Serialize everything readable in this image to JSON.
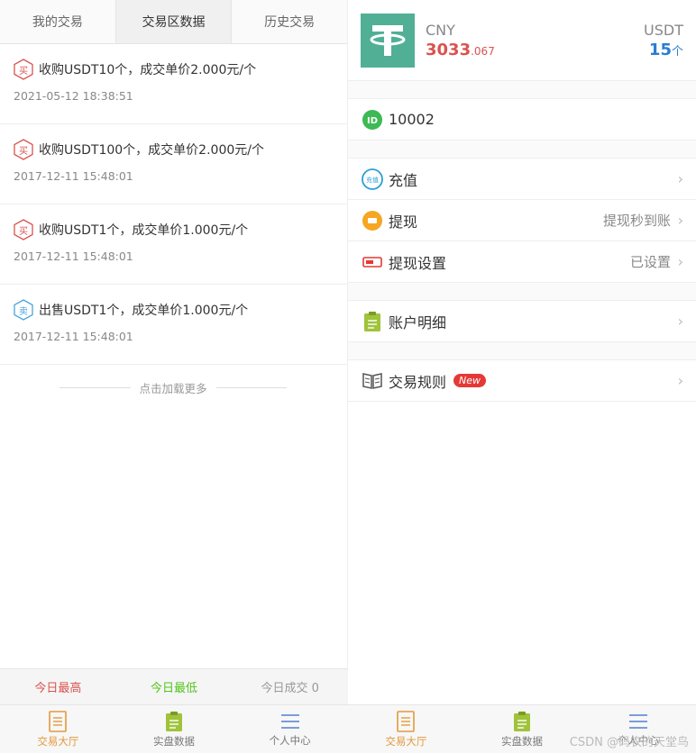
{
  "left": {
    "tabs": [
      "我的交易",
      "交易区数据",
      "历史交易"
    ],
    "active_tab": 1,
    "trades": [
      {
        "type": "buy",
        "badge": "买",
        "text": "收购USDT10个，成交单价2.000元/个",
        "time": "2021-05-12 18:38:51"
      },
      {
        "type": "buy",
        "badge": "买",
        "text": "收购USDT100个，成交单价2.000元/个",
        "time": "2017-12-11 15:48:01"
      },
      {
        "type": "buy",
        "badge": "买",
        "text": "收购USDT1个，成交单价1.000元/个",
        "time": "2017-12-11 15:48:01"
      },
      {
        "type": "sell",
        "badge": "卖",
        "text": "出售USDT1个，成交单价1.000元/个",
        "time": "2017-12-11 15:48:01"
      }
    ],
    "load_more": "点击加载更多",
    "stats": {
      "high": "今日最高",
      "low": "今日最低",
      "volume": "今日成交 0"
    },
    "nav": [
      "交易大厅",
      "实盘数据",
      "个人中心"
    ]
  },
  "right": {
    "cny_label": "CNY",
    "cny_int": "3033",
    "cny_dec": ".067",
    "usdt_label": "USDT",
    "usdt_val": "15",
    "usdt_unit": "个",
    "id": "10002",
    "menu": {
      "recharge": "充值",
      "recharge_icon_text": "充值",
      "withdraw": "提现",
      "withdraw_value": "提现秒到账",
      "withdraw_settings": "提现设置",
      "withdraw_settings_value": "已设置",
      "account_details": "账户明细",
      "rules": "交易规则",
      "new_tag": "New"
    },
    "nav": [
      "交易大厅",
      "实盘数据",
      "个人中心"
    ],
    "watermark": "CSDN @码农的天堂鸟"
  },
  "colors": {
    "red": "#d9534f",
    "green": "#52c41a",
    "blue": "#2a7dd6",
    "tether": "#50af95",
    "orange": "#e39a3b"
  }
}
